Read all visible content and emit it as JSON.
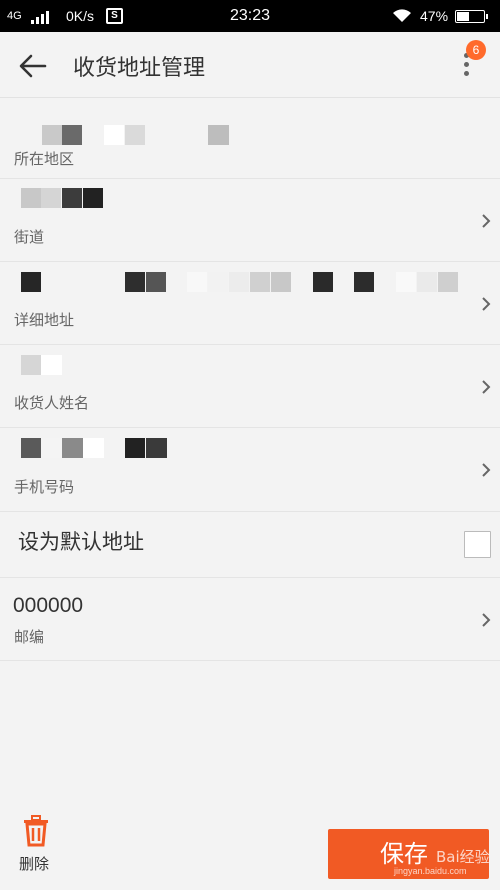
{
  "status_bar": {
    "network": "4G",
    "speed": "0K/s",
    "s_icon": "S",
    "time": "23:23",
    "battery": "47%",
    "icons": [
      "signal-icon",
      "wifi-icon",
      "battery-icon"
    ]
  },
  "app_bar": {
    "title": "收货地址管理",
    "back_icon": "arrow-left-icon",
    "more_icon": "more-vert-icon",
    "badge_count": "6"
  },
  "form": {
    "region": {
      "label": "所在地区"
    },
    "street": {
      "label": "街道"
    },
    "detail": {
      "label": "详细地址"
    },
    "name": {
      "label": "收货人姓名"
    },
    "phone": {
      "label": "手机号码"
    },
    "default": {
      "label": "设为默认地址",
      "checked": false
    },
    "zip": {
      "label": "邮编",
      "value": "000000"
    }
  },
  "footer": {
    "delete_label": "删除",
    "delete_icon": "trash-icon",
    "save_label": "保存",
    "watermark_text": "Bai经验",
    "watermark_url": "jingyan.baidu.com"
  },
  "colors": {
    "accent": "#f15a24",
    "badge": "#ff6a2b",
    "background": "#f3f3f3",
    "status_bar": "#000000"
  }
}
